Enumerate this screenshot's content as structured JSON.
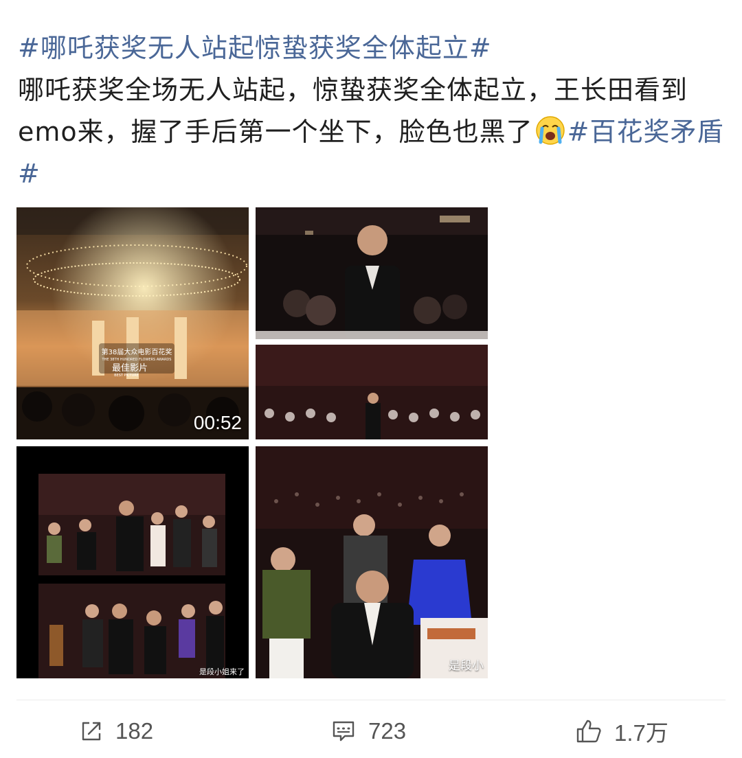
{
  "post": {
    "topic_title": "#哪吒获奖无人站起惊蛰获奖全体起立#",
    "body_text": "哪吒获奖全场无人站起，惊蛰获奖全体起立，王长田看到emo来，握了手后第一个坐下，脸色也黑了",
    "emoji": "crying-face-icon",
    "topic_tag": "#百花奖矛盾#"
  },
  "media": {
    "video_duration": "00:52",
    "watermark_small": "是段小姐来了",
    "watermark_large": "是段小",
    "banner_line1": "第38届大众电影百花奖",
    "banner_line2": "THE 38TH HUNDRED FLOWERS AWARDS",
    "banner_line3": "最佳影片",
    "banner_line4": "BEST PICTURE"
  },
  "actions": {
    "repost_count": "182",
    "comment_count": "723",
    "like_count": "1.7万"
  },
  "colors": {
    "topic": "#4a6797",
    "text": "#1f1f1f",
    "action": "#555555"
  }
}
